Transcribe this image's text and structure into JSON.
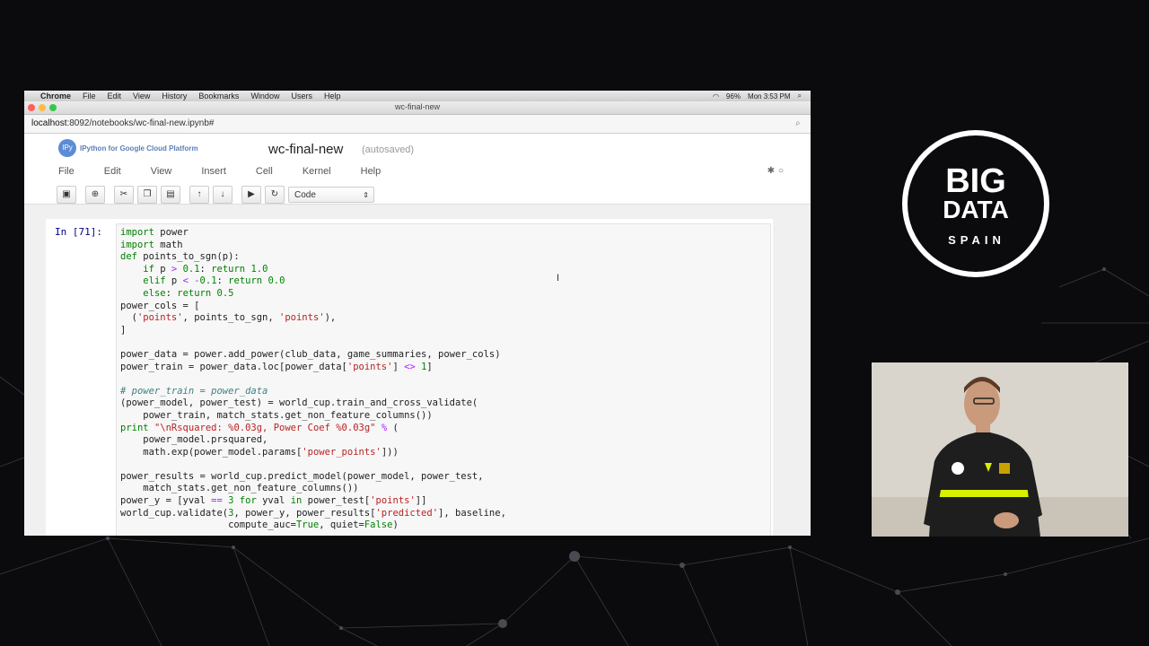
{
  "mac_menubar": {
    "items": [
      "Chrome",
      "File",
      "Edit",
      "View",
      "History",
      "Bookmarks",
      "Window",
      "Users",
      "Help"
    ],
    "battery": "96%",
    "clock": "Mon 3:53 PM"
  },
  "browser": {
    "window_title": "wc-final-new",
    "url_host": "localhost",
    "url_rest": ":8092/notebooks/wc-final-new.ipynb#"
  },
  "notebook": {
    "logo_text": "IPython for Google Cloud Platform",
    "logo_badge": "IPy",
    "name": "wc-final-new",
    "autosave_status": "(autosaved)",
    "menu": [
      "File",
      "Edit",
      "View",
      "Insert",
      "Cell",
      "Kernel",
      "Help"
    ],
    "cell_type_select": "Code",
    "cell_prompt": "In [71]:"
  },
  "toolbar_icons": [
    "save-icon",
    "add-cell-icon",
    "cut-icon",
    "copy-icon",
    "paste-icon",
    "move-up-icon",
    "move-down-icon",
    "run-icon",
    "restart-icon"
  ],
  "code_lines": [
    [
      [
        "kw",
        "import"
      ],
      [
        "t",
        " power"
      ]
    ],
    [
      [
        "kw",
        "import"
      ],
      [
        "t",
        " math"
      ]
    ],
    [
      [
        "kw",
        "def"
      ],
      [
        "t",
        " points_to_sgn(p):"
      ]
    ],
    [
      [
        "t",
        "    "
      ],
      [
        "kw",
        "if"
      ],
      [
        "t",
        " p "
      ],
      [
        "op",
        ">"
      ],
      [
        "t",
        " "
      ],
      [
        "num",
        "0.1"
      ],
      [
        "t",
        ": "
      ],
      [
        "kw",
        "return"
      ],
      [
        "t",
        " "
      ],
      [
        "num",
        "1.0"
      ]
    ],
    [
      [
        "t",
        "    "
      ],
      [
        "kw",
        "elif"
      ],
      [
        "t",
        " p "
      ],
      [
        "op",
        "<"
      ],
      [
        "t",
        " "
      ],
      [
        "op",
        "-"
      ],
      [
        "num",
        "0.1"
      ],
      [
        "t",
        ": "
      ],
      [
        "kw",
        "return"
      ],
      [
        "t",
        " "
      ],
      [
        "num",
        "0.0"
      ]
    ],
    [
      [
        "t",
        "    "
      ],
      [
        "kw",
        "else"
      ],
      [
        "t",
        ": "
      ],
      [
        "kw",
        "return"
      ],
      [
        "t",
        " "
      ],
      [
        "num",
        "0.5"
      ]
    ],
    [
      [
        "t",
        "power_cols = ["
      ]
    ],
    [
      [
        "t",
        "  ("
      ],
      [
        "str",
        "'points'"
      ],
      [
        "t",
        ", points_to_sgn, "
      ],
      [
        "str",
        "'points'"
      ],
      [
        "t",
        "),"
      ]
    ],
    [
      [
        "t",
        "]"
      ]
    ],
    [
      [
        "t",
        ""
      ]
    ],
    [
      [
        "t",
        "power_data = power.add_power(club_data, game_summaries, power_cols)"
      ]
    ],
    [
      [
        "t",
        "power_train = power_data.loc[power_data["
      ],
      [
        "str",
        "'points'"
      ],
      [
        "t",
        "] "
      ],
      [
        "op",
        "<>"
      ],
      [
        "t",
        " "
      ],
      [
        "num",
        "1"
      ],
      [
        "t",
        "]"
      ]
    ],
    [
      [
        "t",
        ""
      ]
    ],
    [
      [
        "cm",
        "# power_train = power_data"
      ]
    ],
    [
      [
        "t",
        "(power_model, power_test) = world_cup.train_and_cross_validate("
      ]
    ],
    [
      [
        "t",
        "    power_train, match_stats.get_non_feature_columns())"
      ]
    ],
    [
      [
        "kw",
        "print"
      ],
      [
        "t",
        " "
      ],
      [
        "str",
        "\"\\nRsquared: %0.03g, Power Coef %0.03g\""
      ],
      [
        "t",
        " "
      ],
      [
        "op",
        "%"
      ],
      [
        "t",
        " ("
      ]
    ],
    [
      [
        "t",
        "    power_model.prsquared,"
      ]
    ],
    [
      [
        "t",
        "    math.exp(power_model.params["
      ],
      [
        "str",
        "'power_points'"
      ],
      [
        "t",
        "]))"
      ]
    ],
    [
      [
        "t",
        ""
      ]
    ],
    [
      [
        "t",
        "power_results = world_cup.predict_model(power_model, power_test,"
      ]
    ],
    [
      [
        "t",
        "    match_stats.get_non_feature_columns())"
      ]
    ],
    [
      [
        "t",
        "power_y = [yval "
      ],
      [
        "op",
        "=="
      ],
      [
        "t",
        " "
      ],
      [
        "num",
        "3"
      ],
      [
        "t",
        " "
      ],
      [
        "kw",
        "for"
      ],
      [
        "t",
        " yval "
      ],
      [
        "kw",
        "in"
      ],
      [
        "t",
        " power_test["
      ],
      [
        "str",
        "'points'"
      ],
      [
        "t",
        "]]"
      ]
    ],
    [
      [
        "t",
        "world_cup.validate("
      ],
      [
        "num",
        "3"
      ],
      [
        "t",
        ", power_y, power_results["
      ],
      [
        "str",
        "'predicted'"
      ],
      [
        "t",
        "], baseline,"
      ]
    ],
    [
      [
        "t",
        "                   compute_auc="
      ],
      [
        "kw",
        "True"
      ],
      [
        "t",
        ", quiet="
      ],
      [
        "kw",
        "False"
      ],
      [
        "t",
        ")"
      ]
    ]
  ],
  "conference_logo": {
    "line1": "BIG",
    "line2": "DATA",
    "line3": "SPAIN"
  },
  "colors": {
    "background": "#0b0b0d",
    "code_keyword": "#008000",
    "code_string": "#ba2121",
    "code_operator": "#aa22ff",
    "code_comment": "#408080",
    "prompt": "#000080"
  }
}
